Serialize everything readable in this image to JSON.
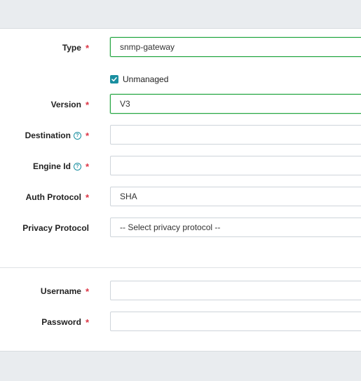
{
  "form": {
    "type": {
      "label": "Type",
      "required_mark": "*",
      "value": "snmp-gateway"
    },
    "unmanaged": {
      "label": "Unmanaged",
      "checked": true
    },
    "version": {
      "label": "Version",
      "required_mark": "*",
      "value": "V3"
    },
    "destination": {
      "label": "Destination",
      "required_mark": "*",
      "value": ""
    },
    "engine_id": {
      "label": "Engine Id",
      "required_mark": "*",
      "value": ""
    },
    "auth_protocol": {
      "label": "Auth Protocol",
      "required_mark": "*",
      "value": "SHA"
    },
    "privacy_protocol": {
      "label": "Privacy Protocol",
      "value": "-- Select privacy protocol --"
    },
    "username": {
      "label": "Username",
      "required_mark": "*",
      "value": ""
    },
    "password": {
      "label": "Password",
      "required_mark": "*",
      "value": ""
    }
  },
  "icons": {
    "help": "?"
  },
  "colors": {
    "accent": "#1a8fa0",
    "required": "#dc3545",
    "focus": "#28a745"
  }
}
